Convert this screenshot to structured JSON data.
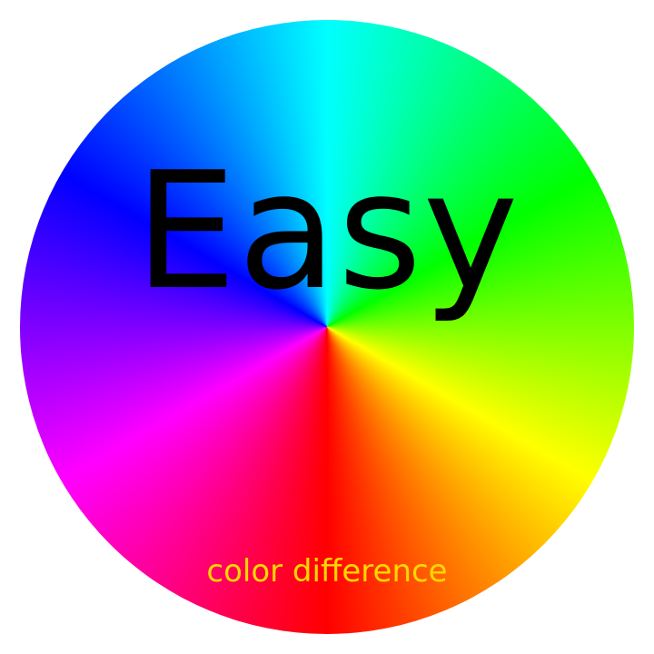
{
  "headline": "Easy",
  "caption": "color difference",
  "colors": {
    "headline_text": "#000000",
    "caption_text": "#ffd700",
    "background": "#ffffff"
  },
  "graphic": {
    "icon": "hue-color-wheel-icon",
    "hues": [
      "#00ffff",
      "#00ff00",
      "#ffff00",
      "#ff0000",
      "#ff00ff",
      "#0000ff"
    ]
  }
}
